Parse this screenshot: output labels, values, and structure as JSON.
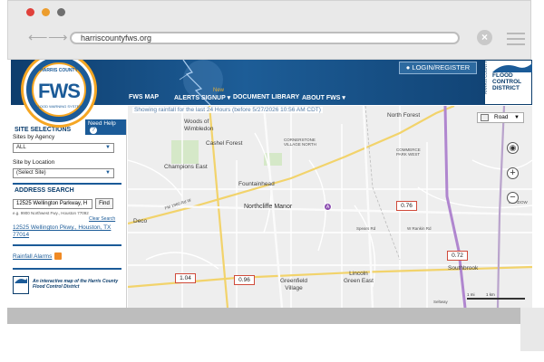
{
  "browser": {
    "url": "harriscountyfws.org",
    "back_icon": "arrow-left-icon",
    "forward_icon": "arrow-right-icon",
    "close_icon": "close-icon",
    "menu_icon": "hamburger-menu-icon"
  },
  "header": {
    "logo_top": "HARRIS COUNTY",
    "logo_main": "FWS",
    "logo_bottom": "FLOOD WARNING SYSTEM",
    "login_label": "LOGIN/REGISTER",
    "agency_logo_text": "FLOOD CONTROL DISTRICT",
    "agency_vertical_text": "HARRIS COUNTY",
    "nav": [
      {
        "label": "FWS MAP"
      },
      {
        "label": "ALERTS SIGNUP ▾"
      },
      {
        "label": "DOCUMENT LIBRARY"
      },
      {
        "label": "ABOUT FWS ▾"
      }
    ],
    "new_badge": "New",
    "colors": {
      "brand_blue": "#1b5b98",
      "accent_orange": "#f5a623"
    }
  },
  "sidebar": {
    "need_help": "Need Help",
    "help_icon": "?",
    "site_selections_heading": "SITE SELECTIONS",
    "sites_by_agency_label": "Sites by Agency",
    "sites_by_agency_value": "ALL",
    "site_by_location_label": "Site by Location",
    "site_by_location_value": "(Select Site)",
    "address_search_heading": "ADDRESS SEARCH",
    "address_input_value": "12525 Wellington Parkway, H",
    "find_label": "Find",
    "example_text": "e.g. 9900 Northwest Fwy., Houston 77092",
    "clear_search": "Clear Search",
    "address_result": "12525 Wellington Pkwy., Houston, TX 77014",
    "rainfall_alarms": "Rainfall Alarms",
    "footer_text": "An interactive map of the Harris County Flood Control District"
  },
  "map": {
    "status_text": "Showing rainfall for the last 24 Hours (before 5/27/2026 10:56 AM CDT)",
    "layer_label": "Road",
    "zoom_in": "+",
    "zoom_out": "−",
    "locate_icon": "locate-icon",
    "scale_text": "1 mi          1 km",
    "marker_label": "A",
    "places": [
      {
        "label": "Woods of\nWimbledon"
      },
      {
        "label": "Cashel Forest"
      },
      {
        "label": "Champions East"
      },
      {
        "label": "Fountainhead"
      },
      {
        "label": "Northcliffe Manor"
      },
      {
        "label": "North Forest"
      },
      {
        "label": "Deco"
      },
      {
        "label": "Greenfield\nVillage"
      },
      {
        "label": "Lincoln\nGreen East"
      },
      {
        "label": "Southbrook"
      },
      {
        "label": "CORNERSTONE\nVILLAGE NORTH"
      },
      {
        "label": "COMMERCE\nPARK WEST"
      },
      {
        "label": "MEADOW"
      }
    ],
    "gauges": [
      {
        "value": "0.76"
      },
      {
        "value": "0.72"
      },
      {
        "value": "1.04"
      },
      {
        "value": "0.96"
      }
    ],
    "road_labels": [
      {
        "label": "FM 1960 Rd W"
      },
      {
        "label": "Spears Rd"
      },
      {
        "label": "W Rankin Rd"
      },
      {
        "label": "Seltway"
      }
    ]
  }
}
